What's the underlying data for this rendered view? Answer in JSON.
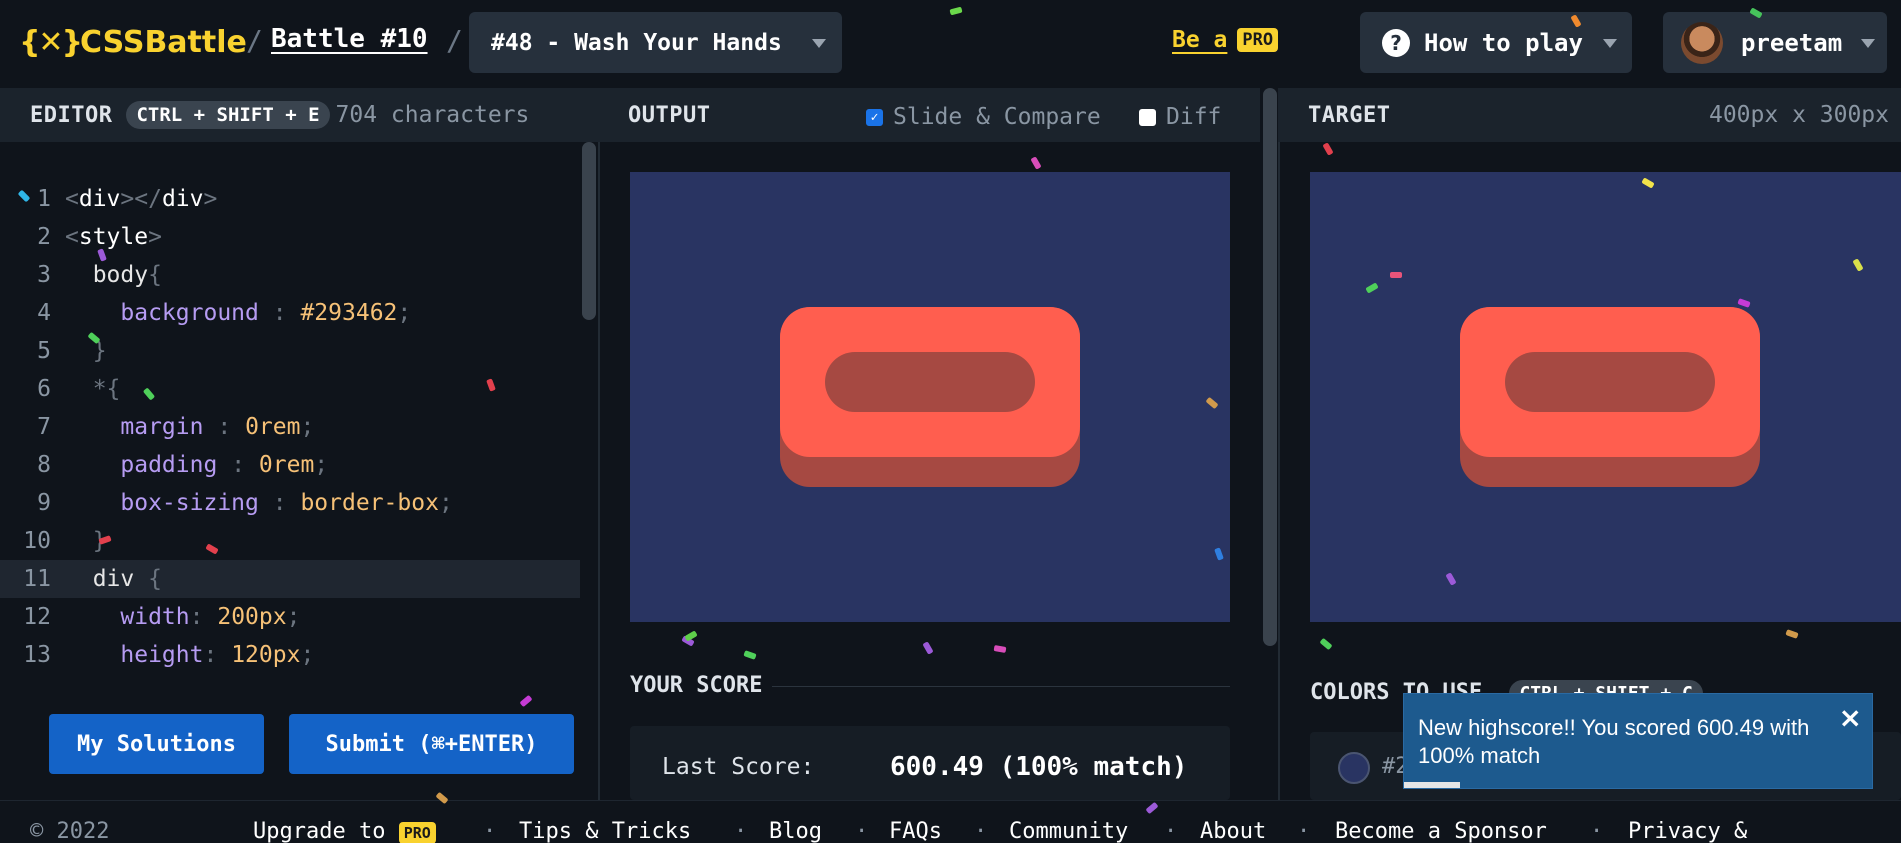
{
  "header": {
    "logo_text": "CSSBattle",
    "battle_label": "Battle #10",
    "target_select": "#48 - Wash Your Hands",
    "be_a": "Be a",
    "pro": "PRO",
    "how_to_play": "How to play",
    "username": "preetam"
  },
  "editor": {
    "title": "EDITOR",
    "shortcut": "CTRL + SHIFT + E",
    "char_count": "704 characters",
    "lines": [
      {
        "n": "1",
        "text": "<div></div>"
      },
      {
        "n": "2",
        "text": "<style>"
      },
      {
        "n": "3",
        "text": "  body{"
      },
      {
        "n": "4",
        "text": "    background : #293462;"
      },
      {
        "n": "5",
        "text": "  }"
      },
      {
        "n": "6",
        "text": "  *{"
      },
      {
        "n": "7",
        "text": "    margin : 0rem;"
      },
      {
        "n": "8",
        "text": "    padding : 0rem;"
      },
      {
        "n": "9",
        "text": "    box-sizing : border-box;"
      },
      {
        "n": "10",
        "text": "  }"
      },
      {
        "n": "11",
        "text": "  div {"
      },
      {
        "n": "12",
        "text": "    width: 200px;"
      },
      {
        "n": "13",
        "text": "    height: 120px;"
      }
    ],
    "my_solutions": "My Solutions",
    "submit": "Submit (⌘+ENTER)"
  },
  "output": {
    "title": "OUTPUT",
    "slide_compare": "Slide & Compare",
    "slide_compare_checked": true,
    "diff": "Diff",
    "diff_checked": false,
    "score_title": "YOUR SCORE",
    "last_score_label": "Last Score:",
    "last_score_value": "600.49 (100% match)"
  },
  "target": {
    "title": "TARGET",
    "size": "400px x 300px",
    "colors_title": "COLORS TO USE",
    "colors_shortcut": "CTRL + SHIFT + C",
    "color_1": "#293462",
    "color_1_label": "#2"
  },
  "toast": {
    "message": "New highscore!! You scored 600.49 with 100% match",
    "close": "×",
    "progress": 0.12
  },
  "footer": {
    "copyright": "© 2022",
    "upgrade": "Upgrade to",
    "pro": "PRO",
    "links": [
      "Tips & Tricks",
      "Blog",
      "FAQs",
      "Community",
      "About",
      "Become a Sponsor",
      "Privacy &"
    ],
    "sep": "·"
  },
  "colors": {
    "background": "#0f141b",
    "canvas": "#293462",
    "soap_light": "#ff5e4f",
    "soap_dark": "#a64942",
    "accent_yellow": "#f9d22f",
    "button_blue": "#1463c7"
  }
}
